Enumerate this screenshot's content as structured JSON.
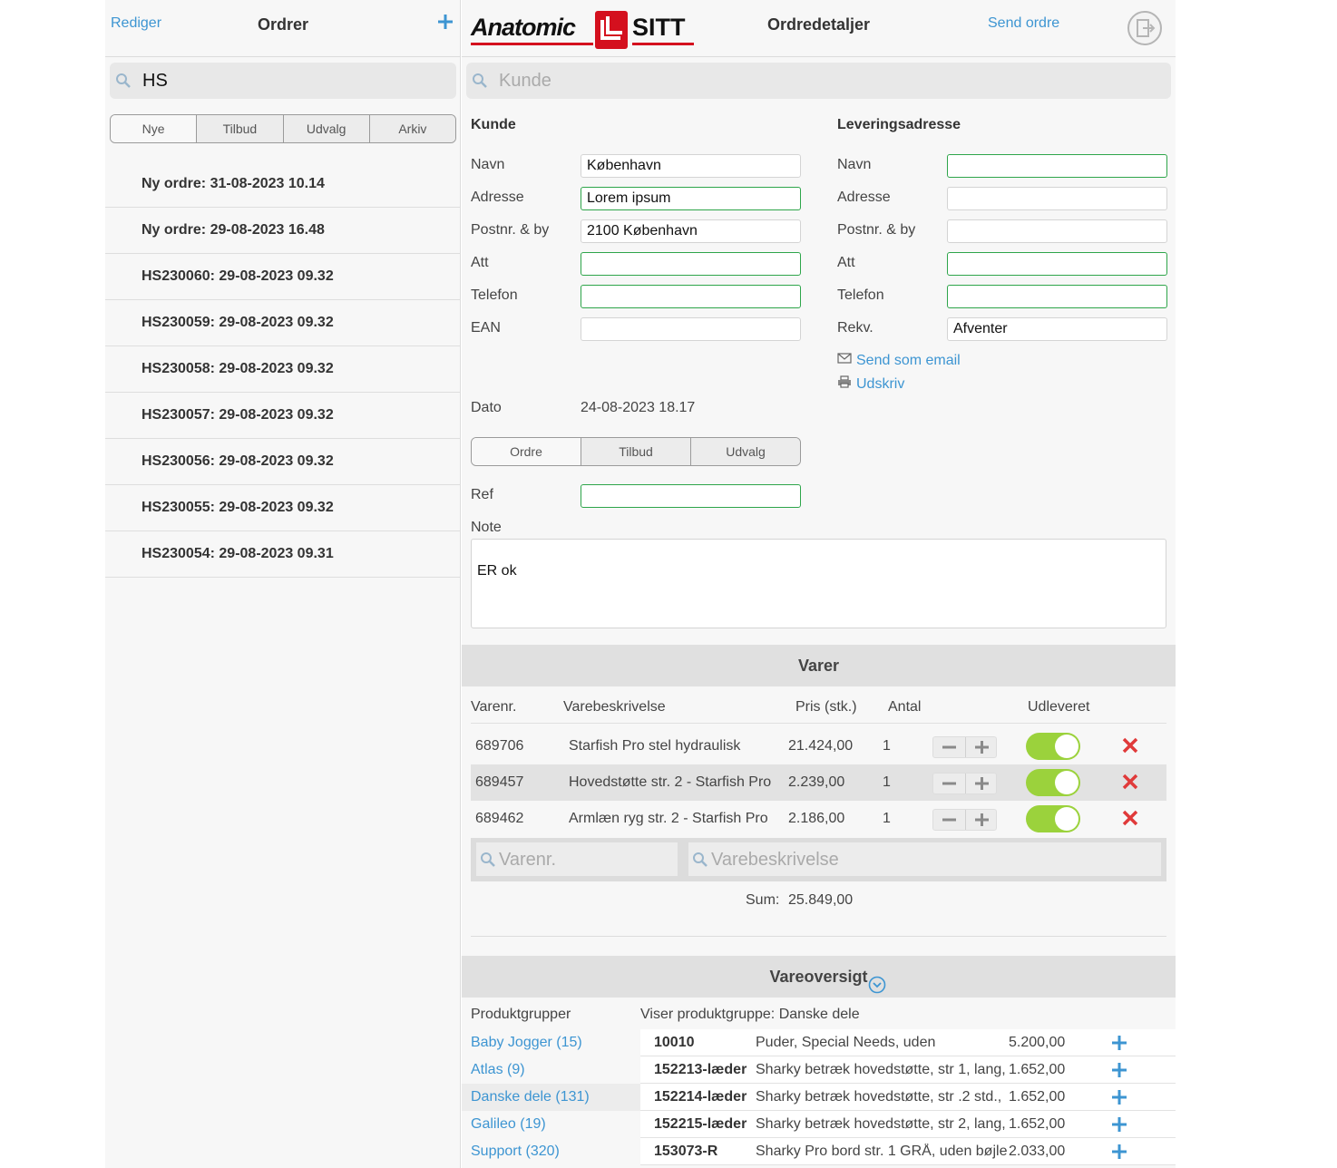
{
  "orders_panel": {
    "edit_label": "Rediger",
    "title": "Ordrer",
    "add_icon": "plus-icon",
    "search_value": "HS",
    "filter_tabs": [
      "Nye",
      "Tilbud",
      "Udvalg",
      "Arkiv"
    ],
    "orders": [
      "Ny ordre: 31-08-2023 10.14",
      "Ny ordre: 29-08-2023 16.48",
      "HS230060: 29-08-2023 09.32",
      "HS230059: 29-08-2023 09.32",
      "HS230058: 29-08-2023 09.32",
      "HS230057: 29-08-2023 09.32",
      "HS230056: 29-08-2023 09.32",
      "HS230055: 29-08-2023 09.32",
      "HS230054: 29-08-2023 09.31"
    ]
  },
  "details": {
    "logo_text_left": "Anatomic",
    "logo_text_right": "SITT",
    "title": "Ordredetaljer",
    "send_label": "Send ordre",
    "logout_icon": "logout-icon",
    "customer_search_placeholder": "Kunde",
    "customer": {
      "heading": "Kunde",
      "name_label": "Navn",
      "name_value": "København",
      "address_label": "Adresse",
      "address_value": "Lorem ipsum",
      "zip_label": "Postnr. & by",
      "zip_value": "2100 København",
      "att_label": "Att",
      "att_value": "",
      "phone_label": "Telefon",
      "phone_value": "",
      "ean_label": "EAN",
      "ean_value": ""
    },
    "delivery": {
      "heading": "Leveringsadresse",
      "name_label": "Navn",
      "name_value": "",
      "address_label": "Adresse",
      "address_value": "",
      "zip_label": "Postnr. & by",
      "zip_value": "",
      "att_label": "Att",
      "att_value": "",
      "phone_label": "Telefon",
      "phone_value": "",
      "rekv_label": "Rekv.",
      "rekv_value": "Afventer",
      "email_label": "Send som email",
      "print_label": "Udskriv"
    },
    "date_label": "Dato",
    "date_value": "24-08-2023 18.17",
    "type_tabs": [
      "Ordre",
      "Tilbud",
      "Udvalg"
    ],
    "ref_label": "Ref",
    "ref_value": "",
    "note_label": "Note",
    "note_value": "ER ok"
  },
  "items": {
    "heading": "Varer",
    "columns": [
      "Varenr.",
      "Varebeskrivelse",
      "Pris (stk.)",
      "Antal",
      "Udleveret"
    ],
    "rows": [
      {
        "nr": "689706",
        "desc": "Starfish Pro stel hydraulisk",
        "price": "21.424,00",
        "qty": "1",
        "delivered": true
      },
      {
        "nr": "689457",
        "desc": "Hovedstøtte str. 2 - Starfish Pro",
        "price": "2.239,00",
        "qty": "1",
        "delivered": true
      },
      {
        "nr": "689462",
        "desc": "Armlæn ryg str. 2 - Starfish Pro",
        "price": "2.186,00",
        "qty": "1",
        "delivered": true
      }
    ],
    "search_nr_placeholder": "Varenr.",
    "search_desc_placeholder": "Varebeskrivelse",
    "sum_label": "Sum:",
    "sum_value": "25.849,00"
  },
  "overview": {
    "heading": "Vareoversigt",
    "groups_label": "Produktgrupper",
    "showing_label": "Viser produktgruppe: Danske dele",
    "groups": [
      "Baby Jogger (15)",
      "Atlas (9)",
      "Danske dele (131)",
      "Galileo (19)",
      "Support (320)"
    ],
    "products": [
      {
        "nr": "10010",
        "desc": "Puder, Special Needs, uden",
        "price": "5.200,00"
      },
      {
        "nr": "152213-læder",
        "desc": "Sharky betræk hovedstøtte, str 1, lang,",
        "price": "1.652,00"
      },
      {
        "nr": "152214-læder",
        "desc": "Sharky betræk hovedstøtte, str .2 std.,",
        "price": "1.652,00"
      },
      {
        "nr": "152215-læder",
        "desc": "Sharky betræk hovedstøtte, str 2, lang,",
        "price": "1.652,00"
      },
      {
        "nr": "153073-R",
        "desc": "Sharky Pro bord str. 1 GRÅ, uden bøjle",
        "price": "2.033,00"
      }
    ]
  },
  "colors": {
    "accent": "#3d95d2",
    "toggle_on": "#9bd23c",
    "valid_border": "#2ea54a",
    "delete": "#e03a3a",
    "logo_red": "#d4101e"
  }
}
